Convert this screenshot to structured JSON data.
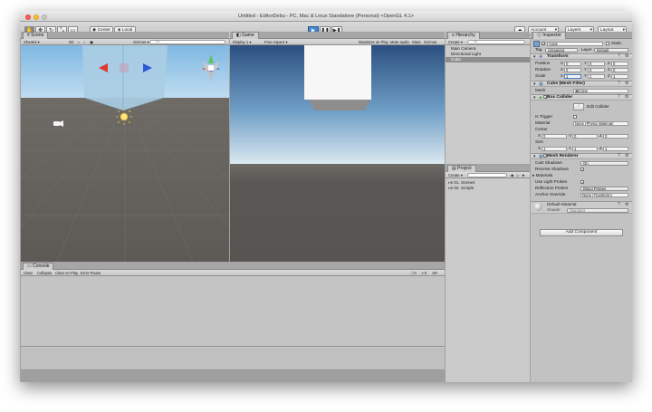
{
  "window": {
    "title": "Untitled - EditorDebu - PC, Mac & Linux Standalone (Personal) <OpenGL 4.1>"
  },
  "toolbar": {
    "tools": [
      "✋",
      "✥",
      "↻",
      "⤡",
      "▭"
    ],
    "center_label": "Center",
    "local_label": "Local",
    "play_glyphs": [
      "▶",
      "❚❚",
      "▶❚"
    ],
    "cloud_glyph": "☁",
    "account_label": "Account",
    "layers_label": "Layers",
    "layout_label": "Layout"
  },
  "scene": {
    "tab_label": "Scene",
    "shaded_label": "Shaded",
    "mode_2d": "2D",
    "gizmos_label": "Gizmos",
    "search_placeholder": "All"
  },
  "game": {
    "tab_label": "Game",
    "display_label": "Display 1",
    "aspect_label": "Free Aspect",
    "maximize_label": "Maximize on Play",
    "mute_label": "Mute audio",
    "stats_label": "Stats",
    "gizmos_label": "Gizmos"
  },
  "hierarchy": {
    "tab_label": "Hierarchy",
    "create_label": "Create",
    "search_placeholder": "All",
    "items": [
      "Main Camera",
      "Directional Light",
      "Cube"
    ]
  },
  "project": {
    "tab_label": "Project",
    "create_label": "Create",
    "folders": [
      "01. Scenes",
      "02. Scripts"
    ]
  },
  "console": {
    "tab_label": "Console",
    "buttons": [
      "Clear",
      "Collapse",
      "Clear on Play",
      "Error Pause"
    ],
    "counts": [
      "0",
      "0",
      "0"
    ]
  },
  "inspector": {
    "tab_label": "Inspector",
    "object_name": "Cube",
    "static_label": "Static",
    "tag_label": "Tag",
    "tag_value": "Untagged",
    "layer_label": "Layer",
    "layer_value": "Default",
    "transform": {
      "title": "Transform",
      "position_label": "Position",
      "rotation_label": "Rotation",
      "scale_label": "Scale",
      "position": [
        "0",
        "0",
        "0"
      ],
      "rotation": [
        "0",
        "0",
        "0"
      ],
      "scale": [
        "1",
        "1",
        "1"
      ]
    },
    "mesh_filter": {
      "title": "Cube (Mesh Filter)",
      "mesh_label": "Mesh",
      "mesh_value": "Cube"
    },
    "box_collider": {
      "title": "Box Collider",
      "edit_label": "Edit Collider",
      "is_trigger_label": "Is Trigger",
      "material_label": "Material",
      "material_value": "None (Physic Material)",
      "center_label": "Center",
      "center": [
        "0",
        "0",
        "0"
      ],
      "size_label": "Size",
      "size": [
        "1",
        "1",
        "1"
      ]
    },
    "mesh_renderer": {
      "title": "Mesh Renderer",
      "cast_shadows_label": "Cast Shadows",
      "cast_shadows_value": "On",
      "receive_shadows_label": "Receive Shadows",
      "materials_label": "Materials",
      "light_probes_label": "Use Light Probes",
      "reflection_label": "Reflection Probes",
      "reflection_value": "Blend Probes",
      "anchor_label": "Anchor Override",
      "anchor_value": "None (Transform)"
    },
    "material": {
      "name": "Default-Material",
      "shader_label": "Shader",
      "shader_value": "Standard"
    },
    "add_component_label": "Add Component"
  },
  "colors": {
    "scene_sky": "#8ec1e6",
    "scene_ground": "#696560",
    "game_sky_top": "#2f5480",
    "game_horizon": "#d7e5ee",
    "game_ground": "#585552",
    "play_blue": "#3a7bc8"
  }
}
